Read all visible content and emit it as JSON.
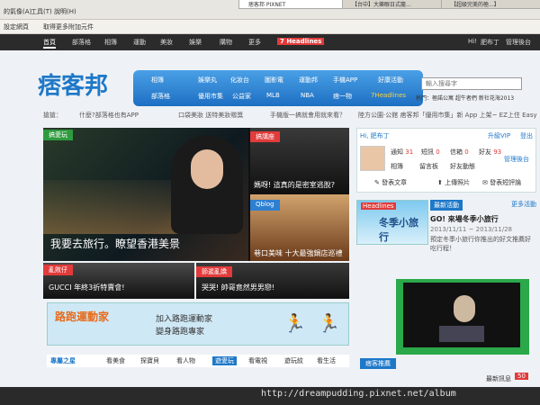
{
  "browser": {
    "menu": [
      "的氣像(A)",
      "工具(T)",
      "說明(H)"
    ],
    "tabs": [
      "痞客邦 PIXNET",
      "【台中】大樂眼日式籠...",
      "【超級完美的極...】"
    ],
    "bookmarks": [
      "設定網頁",
      "取得更多附加元件"
    ]
  },
  "topnav": {
    "items": [
      "首頁",
      "部落格",
      "相簿",
      "運動",
      "美妝",
      "娛樂",
      "購物",
      "更多"
    ],
    "brand": "Headlines",
    "user_links": [
      "Hi!",
      "肥布丁",
      "管理後台"
    ]
  },
  "logo": "痞客邦",
  "mainnav": {
    "row1": [
      "相簿",
      "娛樂丸",
      "化妝台",
      "圖影電",
      "運動邦",
      "手機APP",
      "好康活動"
    ],
    "row2": [
      "部落格",
      "優用市集",
      "公益家",
      "MLB",
      "NBA",
      "痞一物",
      "7Headlines"
    ]
  },
  "search": {
    "placeholder": "輸入搜尋字"
  },
  "hot": "熱門：極諾公寓 超牛者們 新社花海2013",
  "ticker": [
    "搶搶：",
    "什麼?部落格也有APP",
    "口袋美妝 送特美妝贈獎",
    "手機版一搞就會用就來看？",
    "陸方公園·公館 痞客邦「優用市集」新 App 上架~ EZ上住 Easy"
  ],
  "hero": {
    "tag": "搞愛玩",
    "caption": "我要去旅行。瞭望香港美景"
  },
  "tiles": [
    {
      "tag": "搞講座",
      "caption": "媽呀! 這真的是密室逃脫?"
    },
    {
      "tag": "Qblog",
      "caption": "巷口美味 十大最強鍋店巡禮"
    },
    {
      "tag": "亂敗仔",
      "caption": "GUCCI 年終3折特賣會!"
    },
    {
      "tag": "節遲亂嬌",
      "caption": "哭哭! 帥哥竟然男男戀!"
    }
  ],
  "promo": {
    "title": "路跑運動家",
    "line1": "加入路跑運動家",
    "line2": "變身路跑專家"
  },
  "bottomtabs": {
    "title": "專屬之星",
    "items": [
      "看美食",
      "探寶貝",
      "看人物",
      "遊愛玩",
      "看電視",
      "遊玩紋",
      "看生活"
    ]
  },
  "user": {
    "greeting": "Hi, 肥布丁",
    "upgrade": "升級VIP",
    "logout": "登出",
    "stats": [
      {
        "label": "通知",
        "value": "31"
      },
      {
        "label": "短訊",
        "value": "0"
      },
      {
        "label": "信箱",
        "value": "0"
      },
      {
        "label": "好友",
        "value": "93"
      }
    ],
    "links": [
      "相簿",
      "留言板",
      "好友動態"
    ],
    "actions": [
      "發表文章",
      "上傳照片",
      "發表短評論"
    ],
    "manage": "管理後台"
  },
  "news": {
    "badge": "最新活動",
    "more": "更多活動",
    "title": "GO! 來場冬季小旅行",
    "date": "2013/11/11 ~ 2013/11/28",
    "desc": "預定冬季小旅行你推出的好文推薦好吃行程！",
    "ad_title": "冬季小旅行"
  },
  "sidebar_title": "痞客推薦",
  "notif": {
    "label": "最新訊息",
    "count": "50"
  },
  "watermark": "http://dreampudding.pixnet.net/album",
  "colors": {
    "brand": "#1e78c8",
    "accent_red": "#e23b3b",
    "nav_dark": "#2b2b2b"
  }
}
